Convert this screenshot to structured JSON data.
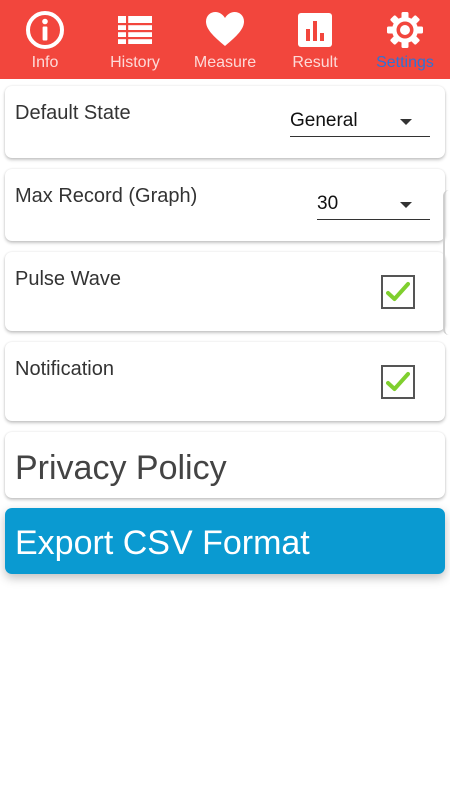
{
  "tabs": [
    {
      "label": "Info",
      "icon": "info-icon"
    },
    {
      "label": "History",
      "icon": "list-icon"
    },
    {
      "label": "Measure",
      "icon": "heart-icon"
    },
    {
      "label": "Result",
      "icon": "bar-chart-icon"
    },
    {
      "label": "Settings",
      "icon": "gear-icon",
      "active": true
    }
  ],
  "settings": {
    "default_state": {
      "label": "Default State",
      "value": "General"
    },
    "max_record": {
      "label": "Max Record (Graph)",
      "value": "30"
    },
    "pulse_wave": {
      "label": "Pulse Wave",
      "checked": true
    },
    "notification": {
      "label": "Notification",
      "checked": true
    }
  },
  "privacy_policy": {
    "label": "Privacy Policy"
  },
  "export": {
    "label": "Export CSV Format"
  },
  "colors": {
    "header": "#f2463d",
    "active_tab": "#2f72d6",
    "export_button": "#0a9ad1",
    "check": "#7fcf2e"
  }
}
